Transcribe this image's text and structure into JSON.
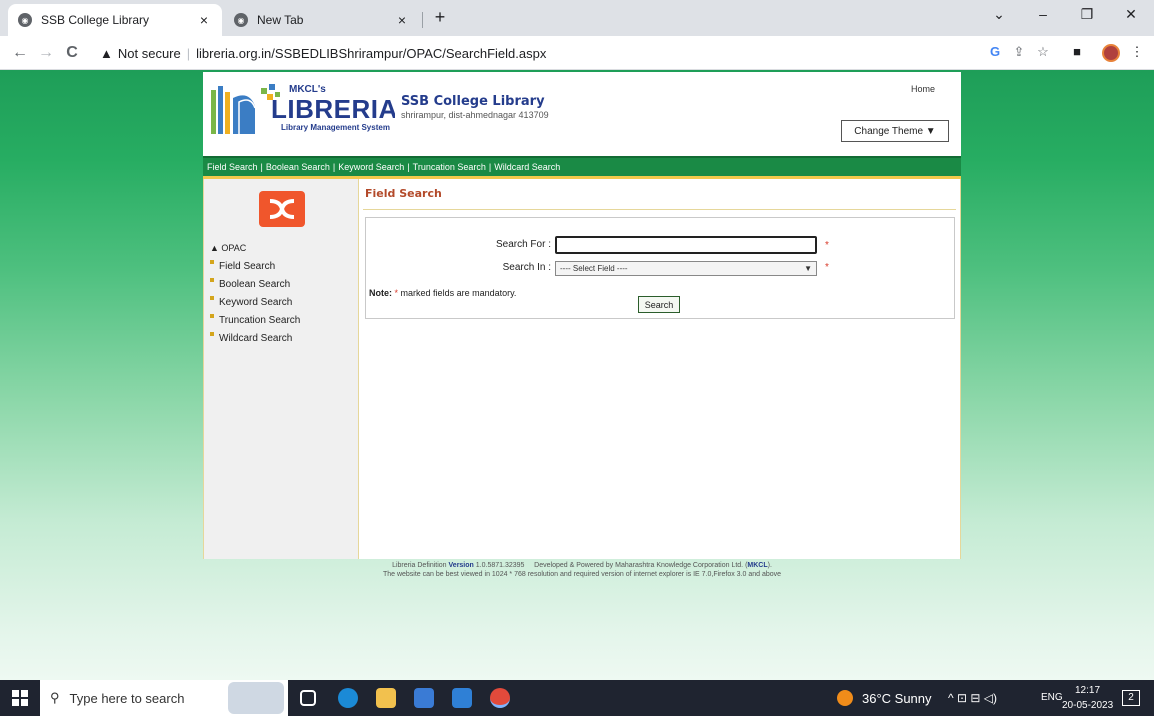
{
  "browser": {
    "tabs": [
      {
        "label": "SSB College Library",
        "close": "×"
      },
      {
        "label": "New Tab",
        "close": "×"
      }
    ],
    "new_tab": "+",
    "window_controls": {
      "collapse": "⌄",
      "minimize": "–",
      "restore": "❐",
      "close": "✕"
    },
    "nav": {
      "back": "←",
      "forward": "→",
      "reload": "C"
    },
    "address": {
      "security_icon": "warning-triangle-icon",
      "security_label": "Not secure",
      "url": "libreria.org.in/SSBEDLIBShrirampur/OPAC/SearchField.aspx"
    },
    "toolbar_icons": [
      "google-g-icon",
      "share-icon",
      "bookmark-star-icon",
      "side-panel-icon",
      "profile-avatar-icon",
      "menu-kebab-icon"
    ]
  },
  "site": {
    "logo": {
      "small": "MKCL's",
      "brand": "LIBRERIA",
      "tagline": "Library Management System"
    },
    "college_name": "SSB College Library",
    "college_address": "shrirampur, dist-ahmednagar 413709",
    "home_link": "Home",
    "change_theme": "Change Theme ▼",
    "nav_links": [
      "Field Search",
      "Boolean Search",
      "Keyword Search",
      "Truncation Search",
      "Wildcard Search"
    ],
    "nav_separator": "|",
    "sidebar": {
      "section_title": "▲ OPAC",
      "items": [
        "Field Search",
        "Boolean Search",
        "Keyword Search",
        "Truncation Search",
        "Wildcard Search"
      ]
    },
    "main": {
      "title": "Field Search",
      "search_for_label": "Search For :",
      "search_for_value": "",
      "search_in_label": "Search In :",
      "search_in_selected": "---- Select Field ----",
      "required_mark": "*",
      "note_label": "Note:",
      "note_star": "*",
      "note_text": "marked fields are mandatory.",
      "search_button": "Search"
    },
    "footer": {
      "line1_prefix": "Libreria Definition",
      "version_word": "Version",
      "version_number": "1.0.5871.32395",
      "developed_by": "Developed & Powered by Maharashtra Knowledge Corporation Ltd. (",
      "mkcl": "MKCL",
      "developed_end": ").",
      "line2": "The website can be best viewed in 1024 * 768 resolution and required version of internet explorer is IE 7.0,Firefox 3.0 and above"
    }
  },
  "taskbar": {
    "search_placeholder": "Type here to search",
    "weather": "36°C  Sunny",
    "language": "ENG",
    "time": "12:17",
    "date": "20-05-2023",
    "notification_count": "2",
    "tray_symbols": "^ ⊡ ⊟ ◁)"
  },
  "colors": {
    "page_green_top": "#1e9e58",
    "nav_green": "#1a8a45",
    "title_red": "#b34a2a",
    "college_blue": "#243c8c",
    "required_red": "#d83a2a"
  }
}
